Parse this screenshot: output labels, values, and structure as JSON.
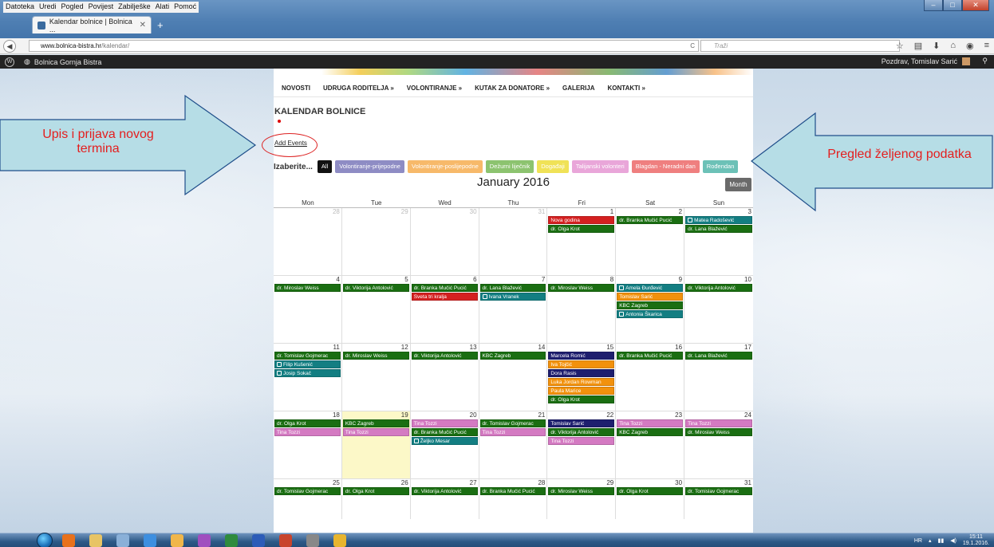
{
  "browser": {
    "menu": [
      "Datoteka",
      "Uredi",
      "Pogled",
      "Povijest",
      "Zabilješke",
      "Alati",
      "Pomoć"
    ],
    "tab_title": "Kalendar bolnice | Bolnica ...",
    "url_domain": "www.bolnica-bistra.hr",
    "url_path": "/kalendar/",
    "search_placeholder": "Traži"
  },
  "adminbar": {
    "site_name": "Bolnica Gornja Bistra",
    "greeting": "Pozdrav, Tomislav Sarić"
  },
  "site_nav": [
    "NOVOSTI",
    "UDRUGA RODITELJA »",
    "VOLONTIRANJE »",
    "KUTAK ZA DONATORE »",
    "GALERIJA",
    "KONTAKTI »"
  ],
  "page": {
    "title": "KALENDAR BOLNICE",
    "add_events": "Add Events",
    "filter_label": "Izaberite...",
    "month_title": "January 2016",
    "view_button": "Month"
  },
  "filters": [
    {
      "label": "All",
      "color": "#111111"
    },
    {
      "label": "Volontiranje-prijepodne",
      "color": "#8e8cc4"
    },
    {
      "label": "Volontiranje-poslijepodne",
      "color": "#f7b96a"
    },
    {
      "label": "Dežurni liječnik",
      "color": "#8cc36f"
    },
    {
      "label": "Događaji",
      "color": "#f0e257"
    },
    {
      "label": "Talijanski volonteri",
      "color": "#e9a6d9"
    },
    {
      "label": "Blagdan - Neradni dan",
      "color": "#ef7f7f"
    },
    {
      "label": "Rođendan",
      "color": "#6cc1b7"
    }
  ],
  "weekdays": [
    "Mon",
    "Tue",
    "Wed",
    "Thu",
    "Fri",
    "Sat",
    "Sun"
  ],
  "event_colors": {
    "green": "#1a6e12",
    "red": "#d42020",
    "teal": "#137e82",
    "orange": "#f2910c",
    "navy": "#1e1e6e",
    "pink": "#d47ac2"
  },
  "weeks": [
    [
      {
        "day": "28",
        "other": true,
        "events": []
      },
      {
        "day": "29",
        "other": true,
        "events": []
      },
      {
        "day": "30",
        "other": true,
        "events": []
      },
      {
        "day": "31",
        "other": true,
        "events": []
      },
      {
        "day": "1",
        "events": [
          {
            "text": "Nova godina",
            "c": "red"
          },
          {
            "text": "dr. Olga Krot",
            "c": "green"
          }
        ]
      },
      {
        "day": "2",
        "events": [
          {
            "text": "dr. Branka Mučić Pucić",
            "c": "green"
          }
        ]
      },
      {
        "day": "3",
        "events": [
          {
            "text": "Matea Radošević",
            "c": "teal",
            "icon": true
          },
          {
            "text": "dr. Lana Blažević",
            "c": "green"
          }
        ]
      }
    ],
    [
      {
        "day": "4",
        "events": [
          {
            "text": "dr. Miroslav Weiss",
            "c": "green"
          }
        ]
      },
      {
        "day": "5",
        "events": [
          {
            "text": "dr. Viktorija Antolović",
            "c": "green"
          }
        ]
      },
      {
        "day": "6",
        "events": [
          {
            "text": "dr. Branka Mučić Pucić",
            "c": "green"
          },
          {
            "text": "Sveta tri kralja",
            "c": "red"
          }
        ]
      },
      {
        "day": "7",
        "events": [
          {
            "text": "dr. Lana Blažević",
            "c": "green"
          },
          {
            "text": "Ivana Vranek",
            "c": "teal",
            "icon": true
          }
        ]
      },
      {
        "day": "8",
        "events": [
          {
            "text": "dr. Miroslav Weiss",
            "c": "green"
          }
        ]
      },
      {
        "day": "9",
        "events": [
          {
            "text": "Amela Đurđević",
            "c": "teal",
            "icon": true
          },
          {
            "text": "Tomislav Sarić",
            "c": "orange"
          },
          {
            "text": "KBC Zagreb",
            "c": "green"
          },
          {
            "text": "Antonia Škarica",
            "c": "teal",
            "icon": true
          }
        ]
      },
      {
        "day": "10",
        "events": [
          {
            "text": "dr. Viktorija Antolović",
            "c": "green"
          }
        ]
      }
    ],
    [
      {
        "day": "11",
        "events": [
          {
            "text": "dr. Tomislav Gojmerac",
            "c": "green"
          },
          {
            "text": "Filip Kušenić",
            "c": "teal",
            "icon": true
          },
          {
            "text": "Josip Sokač",
            "c": "teal",
            "icon": true
          }
        ]
      },
      {
        "day": "12",
        "events": [
          {
            "text": "dr. Miroslav Weiss",
            "c": "green"
          }
        ]
      },
      {
        "day": "13",
        "events": [
          {
            "text": "dr. Viktorija Antolović",
            "c": "green"
          }
        ]
      },
      {
        "day": "14",
        "events": [
          {
            "text": "KBC Zagreb",
            "c": "green"
          }
        ]
      },
      {
        "day": "15",
        "events": [
          {
            "text": "Marcela Romić",
            "c": "navy"
          },
          {
            "text": "Iva Tojčić",
            "c": "orange"
          },
          {
            "text": "Dora Rasis",
            "c": "navy"
          },
          {
            "text": "Luka Jordan Rowman",
            "c": "orange"
          },
          {
            "text": "Paula Marice",
            "c": "orange"
          },
          {
            "text": "dr. Olga Krot",
            "c": "green"
          }
        ]
      },
      {
        "day": "16",
        "events": [
          {
            "text": "dr. Branka Mučić Pucić",
            "c": "green"
          }
        ]
      },
      {
        "day": "17",
        "events": [
          {
            "text": "dr. Lana Blažević",
            "c": "green"
          }
        ]
      }
    ],
    [
      {
        "day": "18",
        "events": [
          {
            "text": "dr. Olga Krot",
            "c": "green"
          },
          {
            "text": "Tina Tozzi",
            "c": "pink"
          }
        ]
      },
      {
        "day": "19",
        "today": true,
        "events": [
          {
            "text": "KBC Zagreb",
            "c": "green"
          },
          {
            "text": "Tina Tozzi",
            "c": "pink"
          }
        ]
      },
      {
        "day": "20",
        "events": [
          {
            "text": "Tina Tozzi",
            "c": "pink"
          },
          {
            "text": "dr. Branka Mučić Pucić",
            "c": "green"
          },
          {
            "text": "Željko Mesar",
            "c": "teal",
            "icon": true
          }
        ]
      },
      {
        "day": "21",
        "events": [
          {
            "text": "dr. Tomislav Gojmerac",
            "c": "green"
          },
          {
            "text": "Tina Tozzi",
            "c": "pink"
          }
        ]
      },
      {
        "day": "22",
        "events": [
          {
            "text": "Tomislav Sarić",
            "c": "navy"
          },
          {
            "text": "dr. Viktorija Antolović",
            "c": "green"
          },
          {
            "text": "Tina Tozzi",
            "c": "pink"
          }
        ]
      },
      {
        "day": "23",
        "events": [
          {
            "text": "Tina Tozzi",
            "c": "pink"
          },
          {
            "text": "KBC Zagreb",
            "c": "green"
          }
        ]
      },
      {
        "day": "24",
        "events": [
          {
            "text": "Tina Tozzi",
            "c": "pink"
          },
          {
            "text": "dr. Miroslav Weiss",
            "c": "green"
          }
        ]
      }
    ],
    [
      {
        "day": "25",
        "events": [
          {
            "text": "dr. Tomislav Gojmerac",
            "c": "green"
          }
        ]
      },
      {
        "day": "26",
        "events": [
          {
            "text": "dr. Olga Krot",
            "c": "green"
          }
        ]
      },
      {
        "day": "27",
        "events": [
          {
            "text": "dr. Viktorija Antolović",
            "c": "green"
          }
        ]
      },
      {
        "day": "28",
        "events": [
          {
            "text": "dr. Branka Mučić Pucić",
            "c": "green"
          }
        ]
      },
      {
        "day": "29",
        "events": [
          {
            "text": "dr. Miroslav Weiss",
            "c": "green"
          }
        ]
      },
      {
        "day": "30",
        "events": [
          {
            "text": "dr. Olga Krot",
            "c": "green"
          }
        ]
      },
      {
        "day": "31",
        "events": [
          {
            "text": "dr. Tomislav Gojmerac",
            "c": "green"
          }
        ]
      }
    ]
  ],
  "annotations": {
    "left": "Upis i prijava novog termina",
    "right": "Pregled željenog podatka"
  },
  "taskbar": {
    "lang": "HR",
    "time": "15:11",
    "date": "19.1.2016."
  }
}
